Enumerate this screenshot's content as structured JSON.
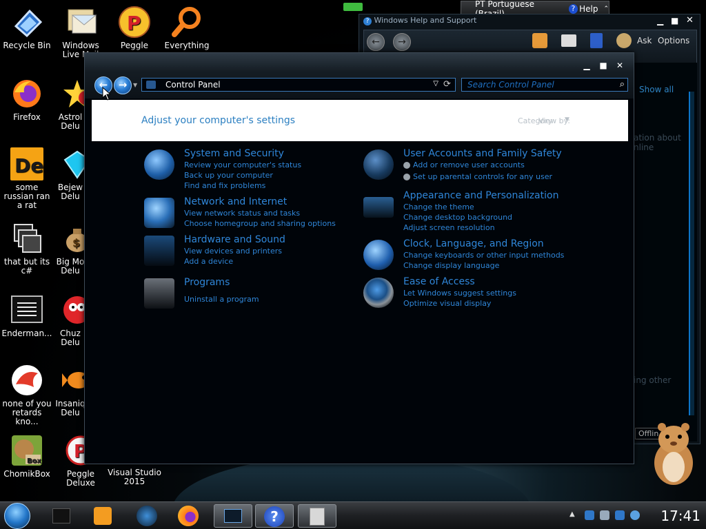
{
  "desktop": {
    "icons": [
      {
        "label": "Recycle Bin",
        "icon": "recycle-bin-icon"
      },
      {
        "label": "Windows Live Mail",
        "icon": "mail-icon"
      },
      {
        "label": "Peggle",
        "icon": "peggle-icon"
      },
      {
        "label": "Everything",
        "icon": "magnifier-icon"
      },
      {
        "label": "Firefox",
        "icon": "firefox-icon"
      },
      {
        "label": "Astrol Delu",
        "icon": "astro-icon"
      },
      {
        "label": "some russian ran a rat",
        "icon": "de-icon"
      },
      {
        "label": "Bejew Delu",
        "icon": "gem-icon"
      },
      {
        "label": "that but its c#",
        "icon": "windows-stack-icon"
      },
      {
        "label": "Big Mo Delu",
        "icon": "money-bag-icon"
      },
      {
        "label": "Enderman...",
        "icon": "list-window-icon"
      },
      {
        "label": "Chuz Delu",
        "icon": "red-creature-icon"
      },
      {
        "label": "none of you retards kno...",
        "icon": "red-bird-icon"
      },
      {
        "label": "Insaniq Delu",
        "icon": "fish-icon"
      },
      {
        "label": "ChomikBox",
        "icon": "hamster-box-icon"
      },
      {
        "label": "Peggle Deluxe",
        "icon": "peggle-icon"
      },
      {
        "label": "Visual Studio 2015",
        "icon": "visual-studio-icon"
      }
    ]
  },
  "langbar": {
    "language": "PT Portuguese (Brazil)",
    "help": "Help"
  },
  "help_window": {
    "title": "Windows Help and Support",
    "ask": "Ask",
    "options": "Options",
    "show_all": "Show all",
    "side_text_1": "ation about",
    "side_text_2": "nline",
    "side_text_3": "ing other",
    "offline": "Offlin"
  },
  "control_panel": {
    "address": "Control Panel",
    "search_placeholder": "Search Control Panel",
    "heading": "Adjust your computer's settings",
    "view_by_label": "View by:",
    "view_by_value": "Category",
    "categories_left": [
      {
        "title": "System and Security",
        "links": [
          "Review your computer's status",
          "Back up your computer",
          "Find and fix problems"
        ]
      },
      {
        "title": "Network and Internet",
        "links": [
          "View network status and tasks",
          "Choose homegroup and sharing options"
        ]
      },
      {
        "title": "Hardware and Sound",
        "links": [
          "View devices and printers",
          "Add a device"
        ]
      },
      {
        "title": "Programs",
        "links": [
          "Uninstall a program"
        ]
      }
    ],
    "categories_right": [
      {
        "title": "User Accounts and Family Safety",
        "links": [
          "Add or remove user accounts",
          "Set up parental controls for any user"
        ]
      },
      {
        "title": "Appearance and Personalization",
        "links": [
          "Change the theme",
          "Change desktop background",
          "Adjust screen resolution"
        ]
      },
      {
        "title": "Clock, Language, and Region",
        "links": [
          "Change keyboards or other input methods",
          "Change display language"
        ]
      },
      {
        "title": "Ease of Access",
        "links": [
          "Let Windows suggest settings",
          "Optimize visual display"
        ]
      }
    ]
  },
  "taskbar": {
    "clock": "17:41"
  },
  "colors": {
    "link": "#2f86d8",
    "accent": "#3b79b8"
  }
}
